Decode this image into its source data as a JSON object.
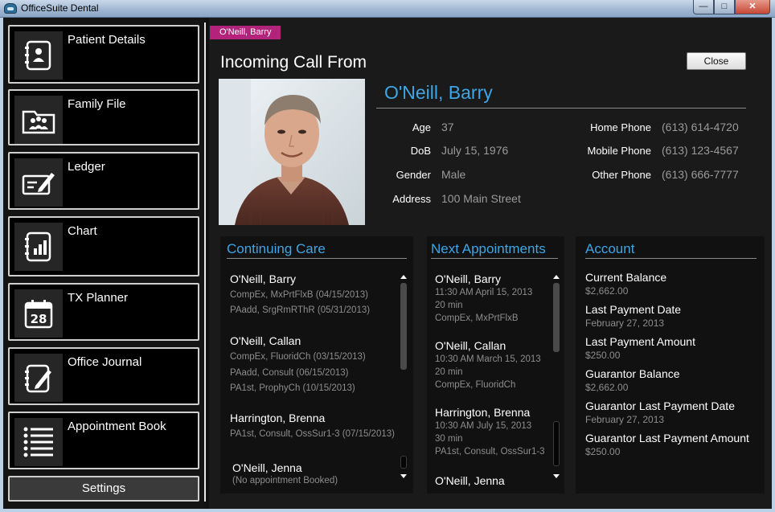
{
  "window": {
    "title": "OfficeSuite Dental",
    "minimize": "—",
    "maximize": "□",
    "close": "✕"
  },
  "sidebar": {
    "items": [
      {
        "label": "Patient Details",
        "icon": "patient-details-icon"
      },
      {
        "label": "Family File",
        "icon": "family-file-icon"
      },
      {
        "label": "Ledger",
        "icon": "ledger-icon"
      },
      {
        "label": "Chart",
        "icon": "chart-icon"
      },
      {
        "label": "TX Planner",
        "icon": "tx-planner-icon"
      },
      {
        "label": "Office Journal",
        "icon": "office-journal-icon"
      },
      {
        "label": "Appointment Book",
        "icon": "appointment-book-icon"
      }
    ],
    "calendar_day": "28",
    "settings_label": "Settings"
  },
  "main": {
    "tag": "O'Neill, Barry",
    "incoming_label": "Incoming Call From",
    "close_label": "Close",
    "patient": {
      "name": "O'Neill, Barry",
      "age_label": "Age",
      "age": "37",
      "dob_label": "DoB",
      "dob": "July 15, 1976",
      "gender_label": "Gender",
      "gender": "Male",
      "address_label": "Address",
      "address": "100 Main Street",
      "home_phone_label": "Home Phone",
      "home_phone": "(613) 614-4720",
      "mobile_phone_label": "Mobile Phone",
      "mobile_phone": "(613) 123-4567",
      "other_phone_label": "Other Phone",
      "other_phone": "(613) 666-7777"
    }
  },
  "continuing_care": {
    "title": "Continuing Care",
    "entries": [
      {
        "name": "O'Neill, Barry",
        "lines": [
          "CompEx, MxPrtFlxB (04/15/2013)",
          "PAadd, SrgRmRThR (05/31/2013)"
        ]
      },
      {
        "name": "O'Neill, Callan",
        "lines": [
          "CompEx, FluoridCh (03/15/2013)",
          "PAadd, Consult (06/15/2013)",
          "PA1st, ProphyCh (10/15/2013)"
        ]
      },
      {
        "name": "Harrington, Brenna",
        "lines": [
          "PA1st, Consult, OssSur1-3 (07/15/2013)"
        ]
      },
      {
        "name": "O'Neill, Jenna",
        "lines": [
          "(No appointment Booked)"
        ]
      }
    ]
  },
  "next_appointments": {
    "title": "Next Appointments",
    "entries": [
      {
        "name": "O'Neill, Barry",
        "lines": [
          "11:30 AM April 15, 2013",
          "20 min",
          "CompEx, MxPrtFlxB"
        ]
      },
      {
        "name": "O'Neill, Callan",
        "lines": [
          "10:30 AM March 15, 2013",
          "20 min",
          "CompEx, FluoridCh"
        ]
      },
      {
        "name": "Harrington, Brenna",
        "lines": [
          "10:30 AM July 15, 2013",
          "30 min",
          "PA1st, Consult, OssSur1-3"
        ]
      },
      {
        "name": "O'Neill, Jenna",
        "lines": []
      }
    ]
  },
  "account": {
    "title": "Account",
    "items": [
      {
        "label": "Current Balance",
        "value": "$2,662.00"
      },
      {
        "label": "Last Payment Date",
        "value": "February 27, 2013"
      },
      {
        "label": "Last Payment Amount",
        "value": "$250.00"
      },
      {
        "label": "Guarantor Balance",
        "value": "$2,662.00"
      },
      {
        "label": "Guarantor Last Payment Date",
        "value": "February 27, 2013"
      },
      {
        "label": "Guarantor Last Payment Amount",
        "value": "$250.00"
      }
    ]
  }
}
